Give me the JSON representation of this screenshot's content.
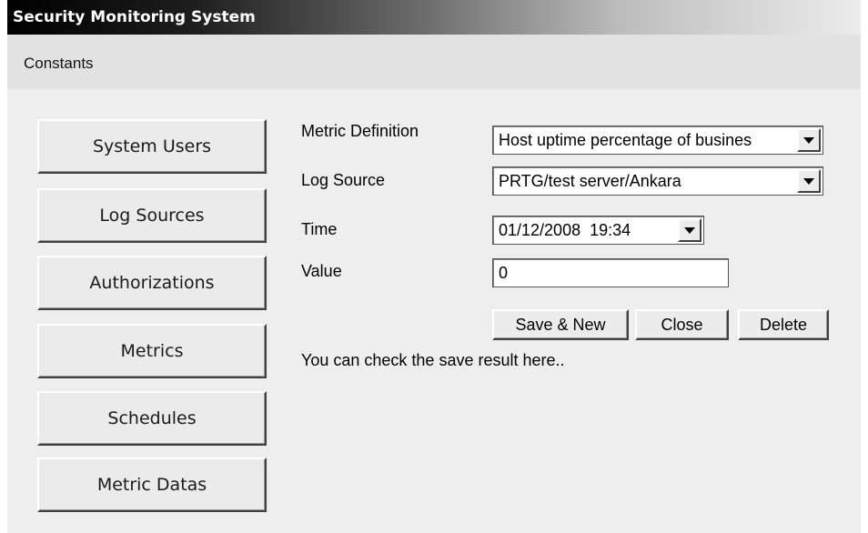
{
  "window": {
    "title": "Security Monitoring System"
  },
  "menu": {
    "items": [
      "Constants"
    ]
  },
  "nav": {
    "buttons": [
      "System Users",
      "Log Sources",
      "Authorizations",
      "Metrics",
      "Schedules",
      "Metric Datas"
    ]
  },
  "form": {
    "metric_definition": {
      "label": "Metric Definition",
      "value": "Host uptime percentage of busines"
    },
    "log_source": {
      "label": "Log Source",
      "value": "PRTG/test server/Ankara"
    },
    "time": {
      "label": "Time",
      "value": "01/12/2008  19:34"
    },
    "value": {
      "label": "Value",
      "value": "0"
    }
  },
  "actions": {
    "save_new": "Save & New",
    "close": "Close",
    "delete": "Delete"
  },
  "status": {
    "text": "You can check the save result here.."
  },
  "icons": {
    "dropdown": "chevron-down-icon"
  }
}
